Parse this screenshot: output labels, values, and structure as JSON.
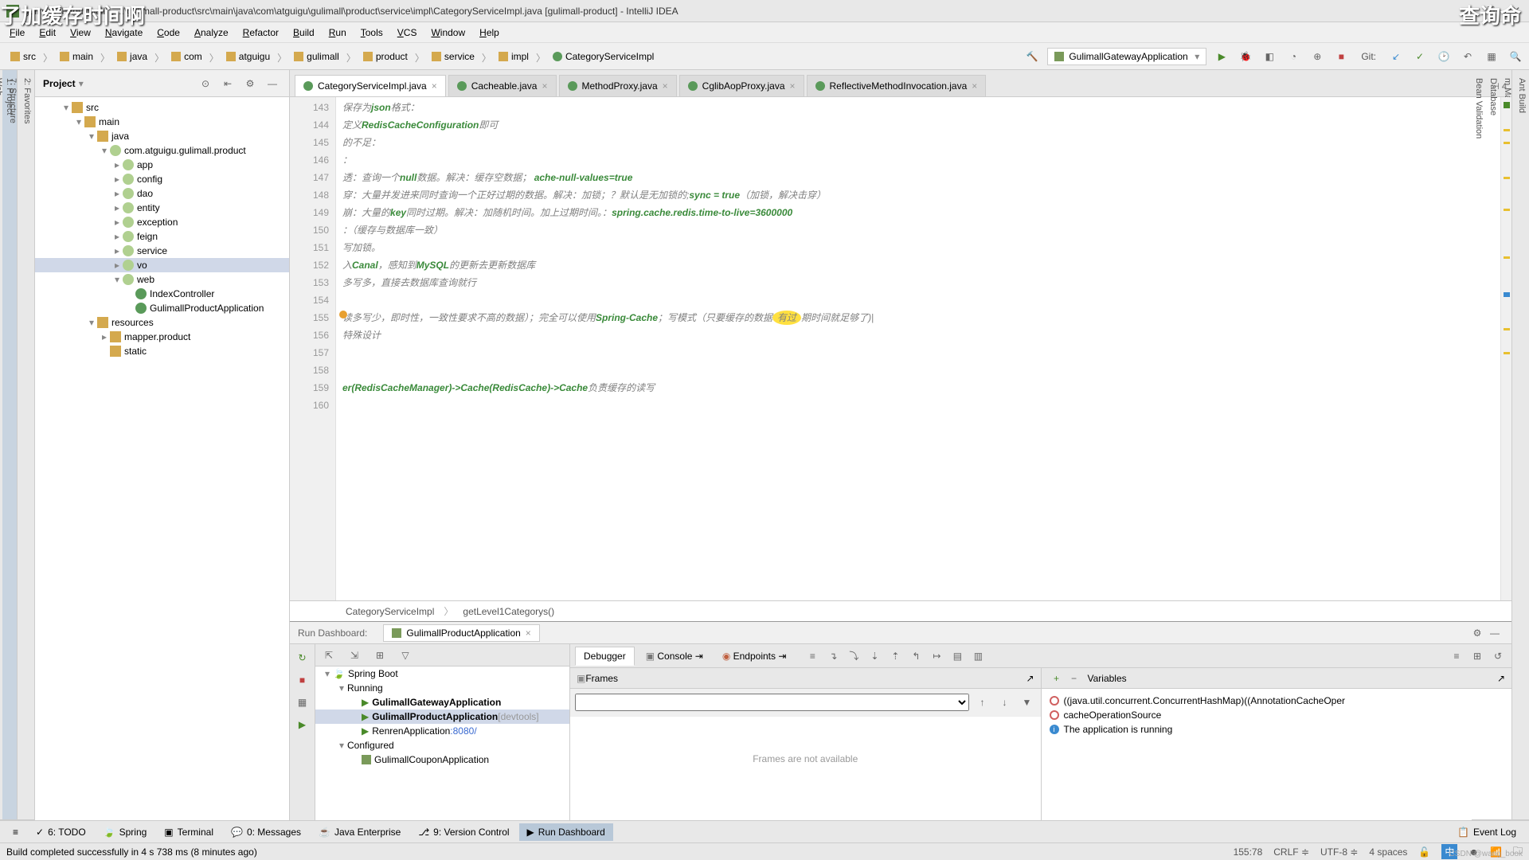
{
  "overlay": {
    "tl": "了加缓存时间啊",
    "tr": "查询命"
  },
  "titlebar": "gulimall [F:\\gulimall] - ...\\gulimall-product\\src\\main\\java\\com\\atguigu\\gulimall\\product\\service\\impl\\CategoryServiceImpl.java [gulimall-product] - IntelliJ IDEA",
  "menu": [
    "File",
    "Edit",
    "View",
    "Navigate",
    "Code",
    "Analyze",
    "Refactor",
    "Build",
    "Run",
    "Tools",
    "VCS",
    "Window",
    "Help"
  ],
  "breadcrumbs": [
    "src",
    "main",
    "java",
    "com",
    "atguigu",
    "gulimall",
    "product",
    "service",
    "impl",
    "CategoryServiceImpl"
  ],
  "run_config": "GulimallGatewayApplication",
  "git_label": "Git:",
  "project": {
    "title": "Project",
    "tree": [
      {
        "d": 2,
        "a": "▾",
        "i": "ico-folder",
        "t": "src"
      },
      {
        "d": 3,
        "a": "▾",
        "i": "ico-folder",
        "t": "main"
      },
      {
        "d": 4,
        "a": "▾",
        "i": "ico-folder",
        "t": "java"
      },
      {
        "d": 5,
        "a": "▾",
        "i": "ico-pkg",
        "t": "com.atguigu.gulimall.product"
      },
      {
        "d": 6,
        "a": "▸",
        "i": "ico-pkg",
        "t": "app"
      },
      {
        "d": 6,
        "a": "▸",
        "i": "ico-pkg",
        "t": "config"
      },
      {
        "d": 6,
        "a": "▸",
        "i": "ico-pkg",
        "t": "dao"
      },
      {
        "d": 6,
        "a": "▸",
        "i": "ico-pkg",
        "t": "entity"
      },
      {
        "d": 6,
        "a": "▸",
        "i": "ico-pkg",
        "t": "exception"
      },
      {
        "d": 6,
        "a": "▸",
        "i": "ico-pkg",
        "t": "feign"
      },
      {
        "d": 6,
        "a": "▸",
        "i": "ico-pkg",
        "t": "service"
      },
      {
        "d": 6,
        "a": "▸",
        "i": "ico-pkg",
        "t": "vo",
        "sel": true
      },
      {
        "d": 6,
        "a": "▾",
        "i": "ico-pkg",
        "t": "web"
      },
      {
        "d": 7,
        "a": "",
        "i": "ico-class",
        "t": "IndexController"
      },
      {
        "d": 7,
        "a": "",
        "i": "ico-class",
        "t": "GulimallProductApplication"
      },
      {
        "d": 4,
        "a": "▾",
        "i": "ico-folder",
        "t": "resources"
      },
      {
        "d": 5,
        "a": "▸",
        "i": "ico-folder",
        "t": "mapper.product"
      },
      {
        "d": 5,
        "a": "",
        "i": "ico-folder",
        "t": "static"
      }
    ]
  },
  "left_strip": [
    "1: Project"
  ],
  "left_strip2": [
    "2: Favorites",
    "7: Structure",
    "Web"
  ],
  "right_strip": [
    "Ant Build",
    "m Maven",
    "Database",
    "Bean Validation"
  ],
  "tabs": [
    {
      "t": "CategoryServiceImpl.java",
      "active": true
    },
    {
      "t": "Cacheable.java"
    },
    {
      "t": "MethodProxy.java"
    },
    {
      "t": "CglibAopProxy.java"
    },
    {
      "t": "ReflectiveMethodInvocation.java"
    }
  ],
  "gutter": [
    "143",
    "144",
    "145",
    "146",
    "147",
    "148",
    "149",
    "150",
    "151",
    "152",
    "153",
    "154",
    "155",
    "156",
    "157",
    "158",
    "159",
    "160"
  ],
  "code": {
    "l143": "保存为<cm-em>json</cm-em>格式：",
    "l144": "定义<cm-em>RedisCacheConfiguration</cm-em>即可",
    "l145": "的不足：",
    "l146": "：",
    "l147": "透：查询一个<cm-em>null</cm-em>数据。解决：缓存空数据； <cm-em>ache-null-values=true</cm-em>",
    "l148": "穿：大量并发进来同时查询一个正好过期的数据。解决：加锁；？默认是无加锁的;<cm-em>sync = true</cm-em>（加锁，解决击穿）",
    "l149": "崩：大量的<cm-em>key</cm-em>同时过期。解决：加随机时间。加上过期时间。：<cm-em>spring.cache.redis.time-to-live=3600000</cm-em>",
    "l150": "：（缓存与数据库一致）",
    "l151": "写加锁。",
    "l152": "入<cm-em>Canal</cm-em>，感知到<cm-em>MySQL</cm-em>的更新去更新数据库",
    "l153": "多写多，直接去数据库查询就行",
    "l154": "",
    "l155": "读多写少，即时性，一致性要求不高的数据）；完全可以使用<cm-em>Spring-Cache</cm-em>；写模式（只要缓存的数据<hl>有过</hl>期时间就足够了)|",
    "l156": "特殊设计",
    "l157": "",
    "l158": "",
    "l159": "<cm-em>er(RedisCacheManager)->Cache(RedisCache)->Cache</cm-em>负责缓存的读写",
    "l160": ""
  },
  "editor_bc": {
    "a": "CategoryServiceImpl",
    "b": "getLevel1Categorys()"
  },
  "run_dash": {
    "title": "Run Dashboard:",
    "app_tab": "GulimallProductApplication",
    "debugger": "Debugger",
    "console": "Console",
    "endpoints": "Endpoints",
    "frames": "Frames",
    "frames_empty": "Frames are not available",
    "variables": "Variables",
    "tree": [
      {
        "d": 0,
        "a": "▾",
        "t": "Spring Boot",
        "run": true
      },
      {
        "d": 1,
        "a": "▾",
        "t": "Running"
      },
      {
        "d": 2,
        "a": "",
        "t": "GulimallGatewayApplication",
        "bold": true,
        "play": true
      },
      {
        "d": 2,
        "a": "",
        "t": "GulimallProductApplication",
        "suffix": "[devtools]",
        "bold": true,
        "play": true,
        "sel": true
      },
      {
        "d": 2,
        "a": "",
        "t": "RenrenApplication",
        "link": ":8080/",
        "play": true
      },
      {
        "d": 1,
        "a": "▾",
        "t": "Configured"
      },
      {
        "d": 2,
        "a": "",
        "t": "GulimallCouponApplication",
        "cfg": true
      }
    ],
    "vars": [
      {
        "t": "((java.util.concurrent.ConcurrentHashMap)((AnnotationCacheOper",
        "ico": "ring"
      },
      {
        "t": "cacheOperationSource",
        "ico": "ring"
      },
      {
        "t": "The application is running",
        "ico": "info"
      }
    ]
  },
  "bottom_tabs": [
    {
      "t": "6: TODO",
      "i": "✓"
    },
    {
      "t": "Spring",
      "i": "🍃"
    },
    {
      "t": "Terminal",
      "i": "▣"
    },
    {
      "t": "0: Messages",
      "i": "💬"
    },
    {
      "t": "Java Enterprise",
      "i": "☕"
    },
    {
      "t": "9: Version Control",
      "i": "⎇"
    },
    {
      "t": "Run Dashboard",
      "i": "▶",
      "active": true
    }
  ],
  "event_log": "Event Log",
  "status": {
    "msg": "Build completed successfully in 4 s 738 ms (8 minutes ago)",
    "pos": "155:78",
    "eol": "CRLF",
    "enc": "UTF-8",
    "indent": "4 spaces",
    "ime": "中"
  },
  "watermark": "CSDN @wang_book"
}
